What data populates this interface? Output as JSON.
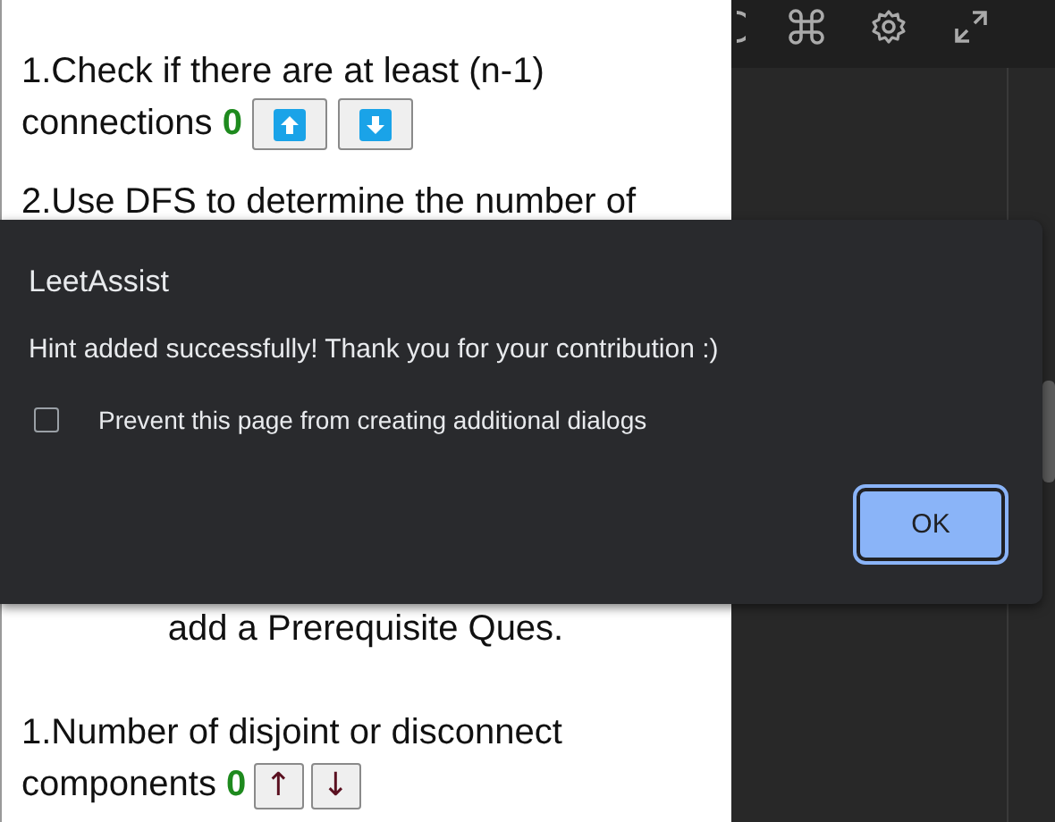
{
  "toolbar": {
    "icons": [
      {
        "kind": "arc"
      },
      {
        "kind": "command"
      },
      {
        "kind": "gear"
      },
      {
        "kind": "expand"
      }
    ]
  },
  "hints": [
    {
      "lines": [
        "1.Check if there are at least (n-1)",
        "connections"
      ],
      "votes": "0",
      "buttons": [
        {
          "kind": "up-icon"
        },
        {
          "kind": "down-icon"
        }
      ]
    },
    {
      "lines": [
        "2.Use DFS to determine the number of"
      ]
    }
  ],
  "prerequisite": {
    "heading": "add a Prerequisite Ques.",
    "hints": [
      {
        "lines": [
          "1.Number of disjoint or disconnect",
          "components"
        ],
        "votes": "0",
        "buttons": [
          {
            "kind": "text",
            "label": "↑"
          },
          {
            "kind": "text",
            "label": "↓"
          }
        ]
      }
    ]
  },
  "dialog": {
    "title": "LeetAssist",
    "message": "Hint added successfully! Thank you for your contribution :)",
    "checkbox": {
      "label": "Prevent this page from creating additional dialogs",
      "checked": false
    },
    "buttons": [
      "OK"
    ]
  }
}
